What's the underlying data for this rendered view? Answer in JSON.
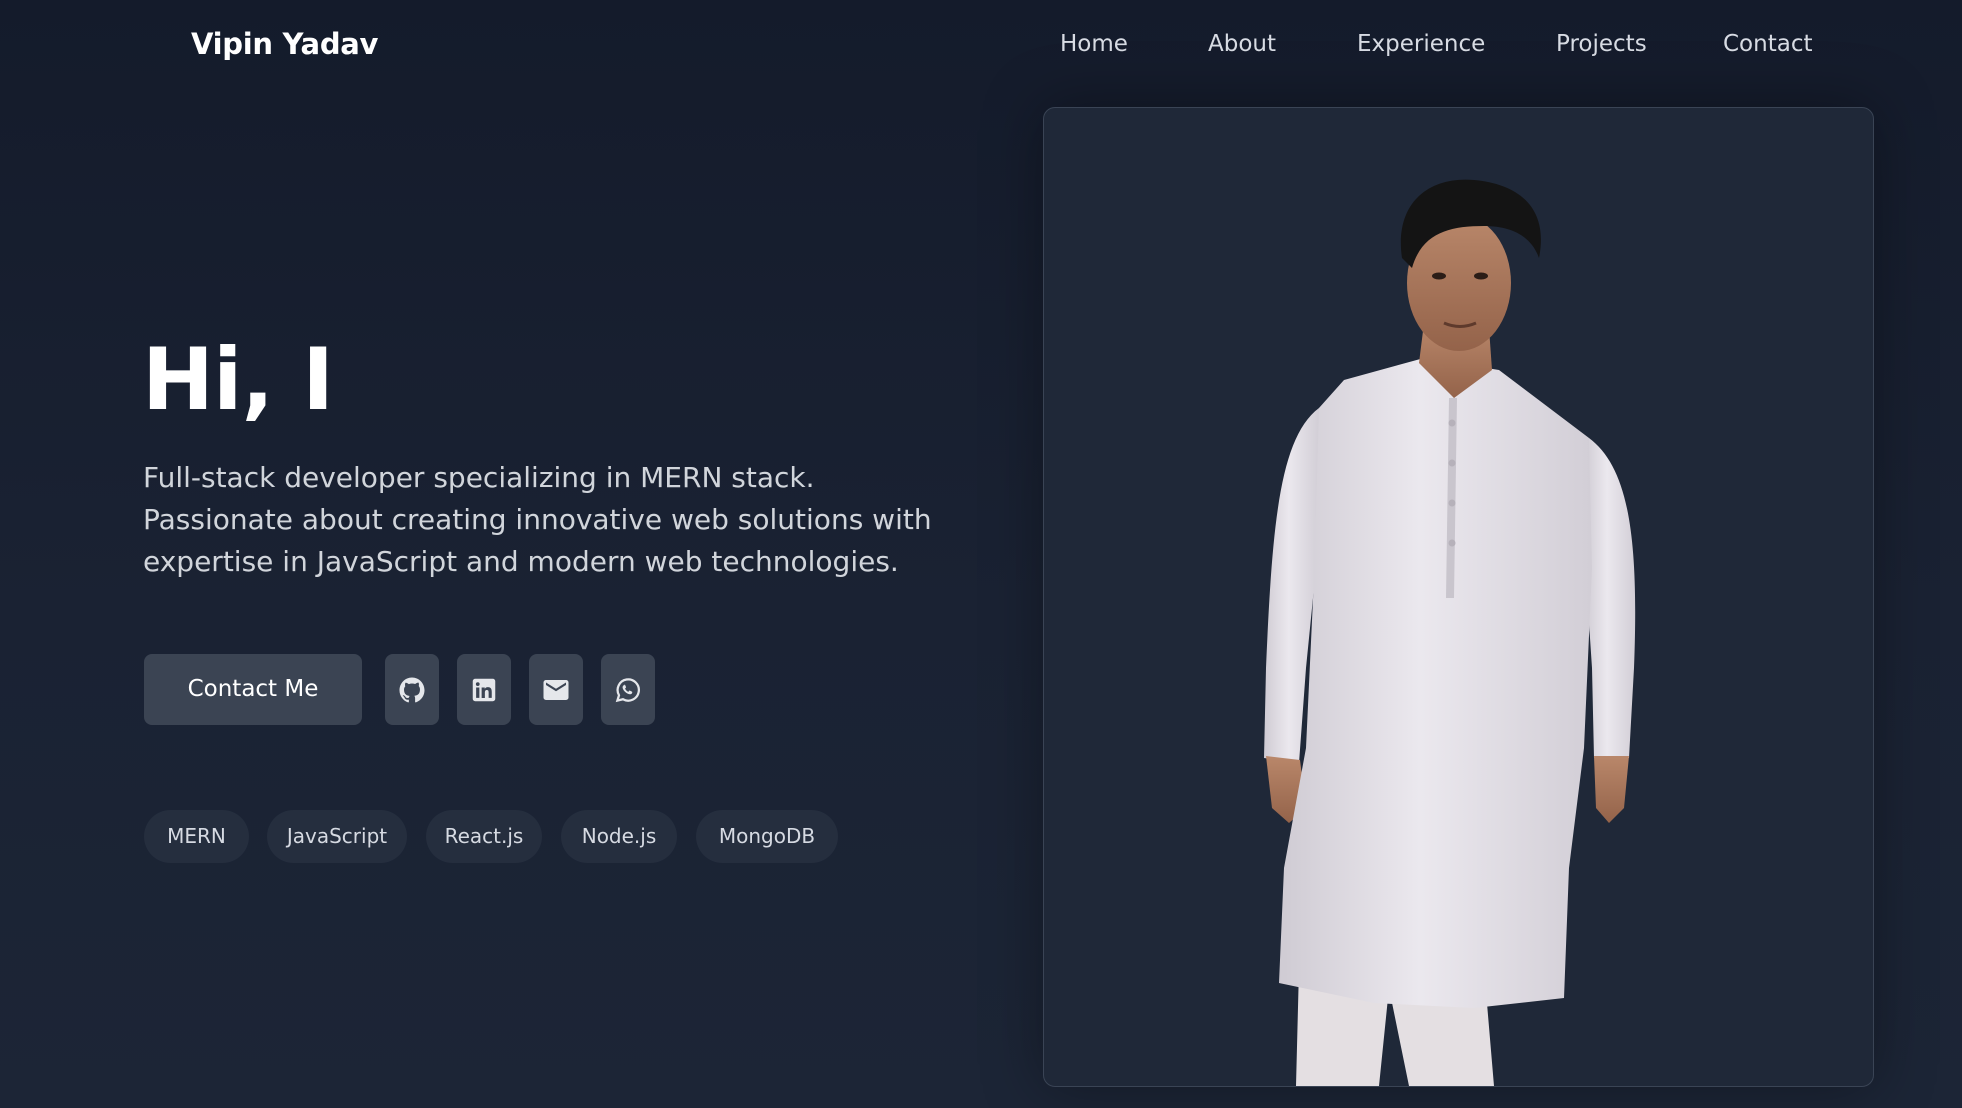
{
  "header": {
    "brand": "Vipin Yadav",
    "nav": [
      {
        "label": "Home"
      },
      {
        "label": "About"
      },
      {
        "label": "Experience"
      },
      {
        "label": "Projects"
      },
      {
        "label": "Contact"
      }
    ]
  },
  "hero": {
    "title": "Hi, I",
    "description": "Full-stack developer specializing in MERN stack. Passionate about creating innovative web solutions with expertise in JavaScript and modern web technologies.",
    "contact_button": "Contact Me",
    "social_icons": [
      "github-icon",
      "linkedin-icon",
      "mail-icon",
      "whatsapp-icon"
    ],
    "tags": [
      "MERN",
      "JavaScript",
      "React.js",
      "Node.js",
      "MongoDB"
    ]
  },
  "colors": {
    "background": "#1a2233",
    "button": "#3b4453",
    "tag": "#252e3e",
    "card": "#1f2838"
  }
}
